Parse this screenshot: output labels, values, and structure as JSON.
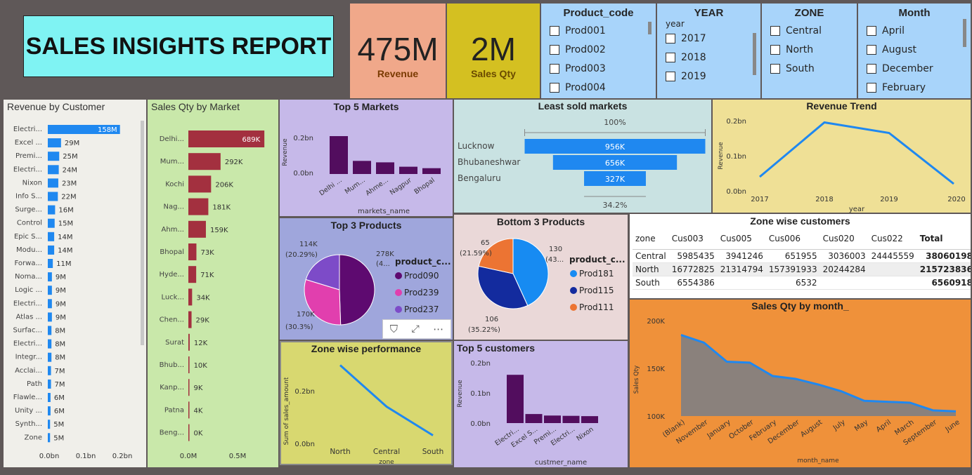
{
  "header": {
    "title": "SALES INSIGHTS REPORT"
  },
  "kpis": {
    "revenue_value": "475M",
    "revenue_label": "Revenue",
    "qty_value": "2M",
    "qty_label": "Sales Qty"
  },
  "slicers": {
    "product": {
      "title": "Product_code",
      "items": [
        "Prod001",
        "Prod002",
        "Prod003",
        "Prod004"
      ]
    },
    "year": {
      "title": "YEAR",
      "field": "year",
      "items": [
        "2017",
        "2018",
        "2019"
      ]
    },
    "zone": {
      "title": "ZONE",
      "items": [
        "Central",
        "North",
        "South"
      ]
    },
    "month": {
      "title": "Month",
      "items": [
        "April",
        "August",
        "December",
        "February"
      ]
    }
  },
  "colors": {
    "bg": "#5f5858",
    "title_box": "#7ff3f3",
    "revenue_card": "#f0a88a",
    "qty_card": "#d4c021",
    "slicer": "#a8d4fa",
    "customer_bar": "#1f88f0",
    "market_bar": "#a3303f",
    "purple_bar": "#520d5e",
    "line": "#1f88f0",
    "orange": "#ef913a"
  },
  "chart_data": [
    {
      "id": "revenue_by_customer",
      "type": "bar",
      "orientation": "horizontal",
      "title": "Revenue by Customer",
      "categories": [
        "Electri...",
        "Excel ...",
        "Premi...",
        "Electri...",
        "Nixon",
        "Info S...",
        "Surge...",
        "Control",
        "Epic S...",
        "Modu...",
        "Forwa...",
        "Noma...",
        "Logic ...",
        "Electri...",
        "Atlas ...",
        "Surfac...",
        "Electri...",
        "Integr...",
        "Acclai...",
        "Path",
        "Flawle...",
        "Unity ...",
        "Synth...",
        "Zone"
      ],
      "values": [
        158,
        29,
        25,
        24,
        23,
        22,
        16,
        15,
        14,
        14,
        11,
        9,
        9,
        9,
        9,
        8,
        8,
        8,
        7,
        7,
        6,
        6,
        5,
        5
      ],
      "labels": [
        "158M",
        "29M",
        "25M",
        "24M",
        "23M",
        "22M",
        "16M",
        "15M",
        "14M",
        "14M",
        "11M",
        "9M",
        "9M",
        "9M",
        "9M",
        "8M",
        "8M",
        "8M",
        "7M",
        "7M",
        "6M",
        "6M",
        "5M",
        "5M"
      ],
      "xticks": [
        "0.0bn",
        "0.1bn",
        "0.2bn"
      ],
      "xlim": [
        0,
        200
      ]
    },
    {
      "id": "sales_qty_by_market",
      "type": "bar",
      "orientation": "horizontal",
      "title": "Sales Qty by Market",
      "categories": [
        "Delhi...",
        "Mum...",
        "Kochi",
        "Nag...",
        "Ahm...",
        "Bhopal",
        "Hyde...",
        "Luck...",
        "Chen...",
        "Surat",
        "Bhub...",
        "Kanp...",
        "Patna",
        "Beng..."
      ],
      "values": [
        689,
        292,
        206,
        181,
        159,
        73,
        71,
        34,
        29,
        12,
        10,
        9,
        4,
        0
      ],
      "labels": [
        "689K",
        "292K",
        "206K",
        "181K",
        "159K",
        "73K",
        "71K",
        "34K",
        "29K",
        "12K",
        "10K",
        "9K",
        "4K",
        "0K"
      ],
      "xticks": [
        "0.0M",
        "0.5M"
      ],
      "xlim": [
        0,
        750
      ]
    },
    {
      "id": "top5_markets",
      "type": "bar",
      "title": "Top 5 Markets",
      "categories": [
        "Delhi ...",
        "Mum...",
        "Ahme...",
        "Nagpur",
        "Bhopal"
      ],
      "values": [
        0.26,
        0.09,
        0.08,
        0.05,
        0.04
      ],
      "ylabel": "Revenue",
      "xlabel": "markets_name",
      "yticks": [
        "0.0bn",
        "0.2bn"
      ],
      "ylim": [
        0,
        0.3
      ]
    },
    {
      "id": "least_sold_markets",
      "type": "funnel",
      "title": "Least sold markets",
      "categories": [
        "Lucknow",
        "Bhubaneshwar",
        "Bengaluru"
      ],
      "values": [
        956,
        656,
        327
      ],
      "labels": [
        "956K",
        "656K",
        "327K"
      ],
      "top_pct": "100%",
      "bottom_pct": "34.2%"
    },
    {
      "id": "revenue_trend",
      "type": "line",
      "title": "Revenue Trend",
      "x": [
        "2017",
        "2018",
        "2019",
        "2020"
      ],
      "values": [
        0.04,
        0.195,
        0.165,
        0.02
      ],
      "ylabel": "Revenue",
      "xlabel": "year",
      "yticks": [
        "0.0bn",
        "0.1bn",
        "0.2bn"
      ],
      "ylim": [
        0,
        0.2
      ]
    },
    {
      "id": "top3_products",
      "type": "pie",
      "title": "Top 3 Products",
      "legend_title": "product_c...",
      "slices": [
        {
          "name": "Prod090",
          "value": 278,
          "label": "278K",
          "pct": "(4...",
          "color": "#5e0a70"
        },
        {
          "name": "Prod239",
          "value": 170,
          "label": "170K",
          "pct": "(30.3%)",
          "color": "#e13fae"
        },
        {
          "name": "Prod237",
          "value": 114,
          "label": "114K",
          "pct": "(20.29%)",
          "color": "#7d4bc8"
        }
      ]
    },
    {
      "id": "bottom3_products",
      "type": "pie",
      "title": "Bottom 3 Products",
      "legend_title": "product_c...",
      "slices": [
        {
          "name": "Prod181",
          "value": 130,
          "label": "130",
          "pct": "(43...",
          "color": "#178bf2"
        },
        {
          "name": "Prod115",
          "value": 106,
          "label": "106",
          "pct": "(35.22%)",
          "color": "#132b9e"
        },
        {
          "name": "Prod111",
          "value": 65,
          "label": "65",
          "pct": "(21.59%)",
          "color": "#ec7433"
        }
      ]
    },
    {
      "id": "zone_performance",
      "type": "line",
      "title": "Zone wise performance",
      "x": [
        "North",
        "Central",
        "South"
      ],
      "values": [
        0.34,
        0.16,
        0.035
      ],
      "ylabel": "Sum of sales_amount",
      "xlabel": "zone",
      "yticks": [
        "0.0bn",
        "0.2bn"
      ],
      "ylim": [
        0,
        0.36
      ]
    },
    {
      "id": "top5_customers",
      "type": "bar",
      "title": "Top 5 customers",
      "categories": [
        "Electri...",
        "Excel S...",
        "Premi...",
        "Electri...",
        "Nixon"
      ],
      "values": [
        0.16,
        0.03,
        0.025,
        0.024,
        0.023
      ],
      "ylabel": "Revenue",
      "xlabel": "custmer_name",
      "yticks": [
        "0.0bn",
        "0.1bn",
        "0.2bn"
      ],
      "ylim": [
        0,
        0.2
      ]
    },
    {
      "id": "zone_customers",
      "type": "table",
      "title": "Zone wise customers",
      "columns": [
        "zone",
        "Cus003",
        "Cus005",
        "Cus006",
        "Cus020",
        "Cus022",
        "Total"
      ],
      "rows": [
        [
          "Central",
          "5985435",
          "3941246",
          "651955",
          "3036003",
          "24445559",
          "38060198"
        ],
        [
          "North",
          "16772825",
          "21314794",
          "157391933",
          "20244284",
          "",
          "215723836"
        ],
        [
          "South",
          "6554386",
          "",
          "6532",
          "",
          "",
          "6560918"
        ]
      ]
    },
    {
      "id": "sales_qty_by_month",
      "type": "area",
      "title": "Sales Qty by month_",
      "x": [
        "(Blank)",
        "November",
        "January",
        "October",
        "February",
        "December",
        "August",
        "July",
        "May",
        "April",
        "March",
        "September",
        "June"
      ],
      "values": [
        185,
        177,
        157,
        156,
        142,
        139,
        133,
        126,
        116,
        115,
        114,
        106,
        105
      ],
      "ylabel": "Sales Qty",
      "xlabel": "month_name",
      "yticks": [
        "100K",
        "150K",
        "200K"
      ],
      "ylim": [
        100,
        200
      ]
    }
  ]
}
